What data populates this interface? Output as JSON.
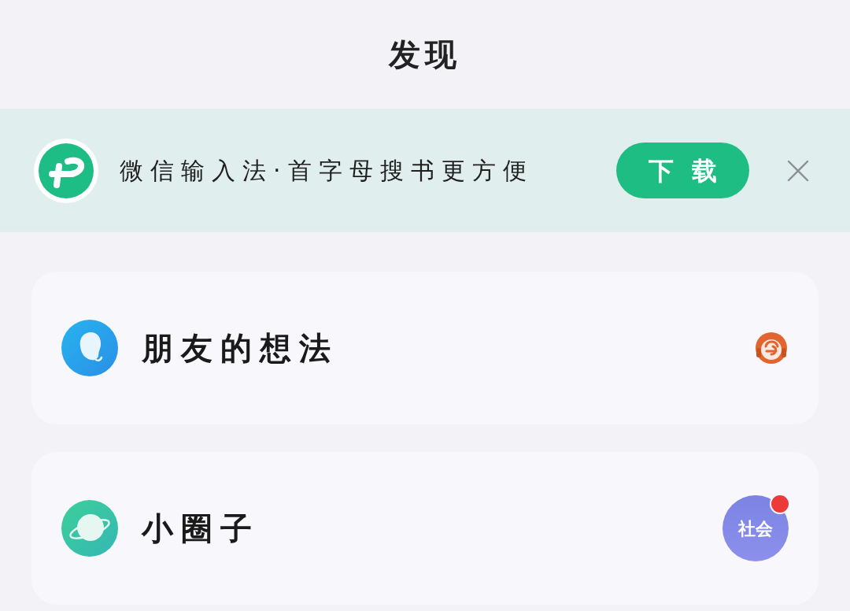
{
  "header": {
    "title": "发现"
  },
  "banner": {
    "text": "微信输入法·首字母搜书更方便",
    "button": "下载",
    "closable": true
  },
  "entries": [
    {
      "kind": "friends",
      "label": "朋友的想法"
    },
    {
      "kind": "groups",
      "label": "小圈子",
      "tag": "社会",
      "unread": true
    }
  ]
}
